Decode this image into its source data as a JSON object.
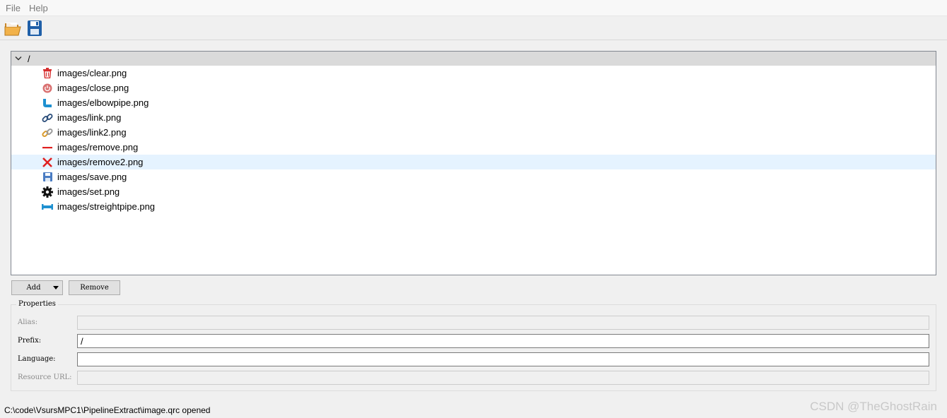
{
  "menubar": {
    "items": [
      {
        "label": "File"
      },
      {
        "label": "Help"
      }
    ]
  },
  "toolbar": {
    "buttons": [
      {
        "icon": "open-folder-icon"
      },
      {
        "icon": "save-icon"
      }
    ]
  },
  "tree": {
    "root": {
      "label": "/",
      "expanded": true
    },
    "items": [
      {
        "label": "images/clear.png",
        "icon": "trash-icon"
      },
      {
        "label": "images/close.png",
        "icon": "power-icon"
      },
      {
        "label": "images/elbowpipe.png",
        "icon": "elbow-pipe-icon"
      },
      {
        "label": "images/link.png",
        "icon": "link-icon"
      },
      {
        "label": "images/link2.png",
        "icon": "link2-icon"
      },
      {
        "label": "images/remove.png",
        "icon": "minus-icon"
      },
      {
        "label": "images/remove2.png",
        "icon": "x-icon",
        "selected": true
      },
      {
        "label": "images/save.png",
        "icon": "save-icon"
      },
      {
        "label": "images/set.png",
        "icon": "gear-icon"
      },
      {
        "label": "images/streightpipe.png",
        "icon": "straight-pipe-icon"
      }
    ]
  },
  "buttons": {
    "add_label": "Add",
    "remove_label": "Remove"
  },
  "properties": {
    "title": "Properties",
    "alias_label": "Alias:",
    "alias_value": "",
    "prefix_label": "Prefix:",
    "prefix_value": "/",
    "language_label": "Language:",
    "language_value": "",
    "resource_url_label": "Resource URL:",
    "resource_url_value": ""
  },
  "status": {
    "text": "C:\\code\\VsursMPC1\\PipelineExtract\\image.qrc opened"
  },
  "watermark": {
    "text": "CSDN @TheGhostRain"
  }
}
